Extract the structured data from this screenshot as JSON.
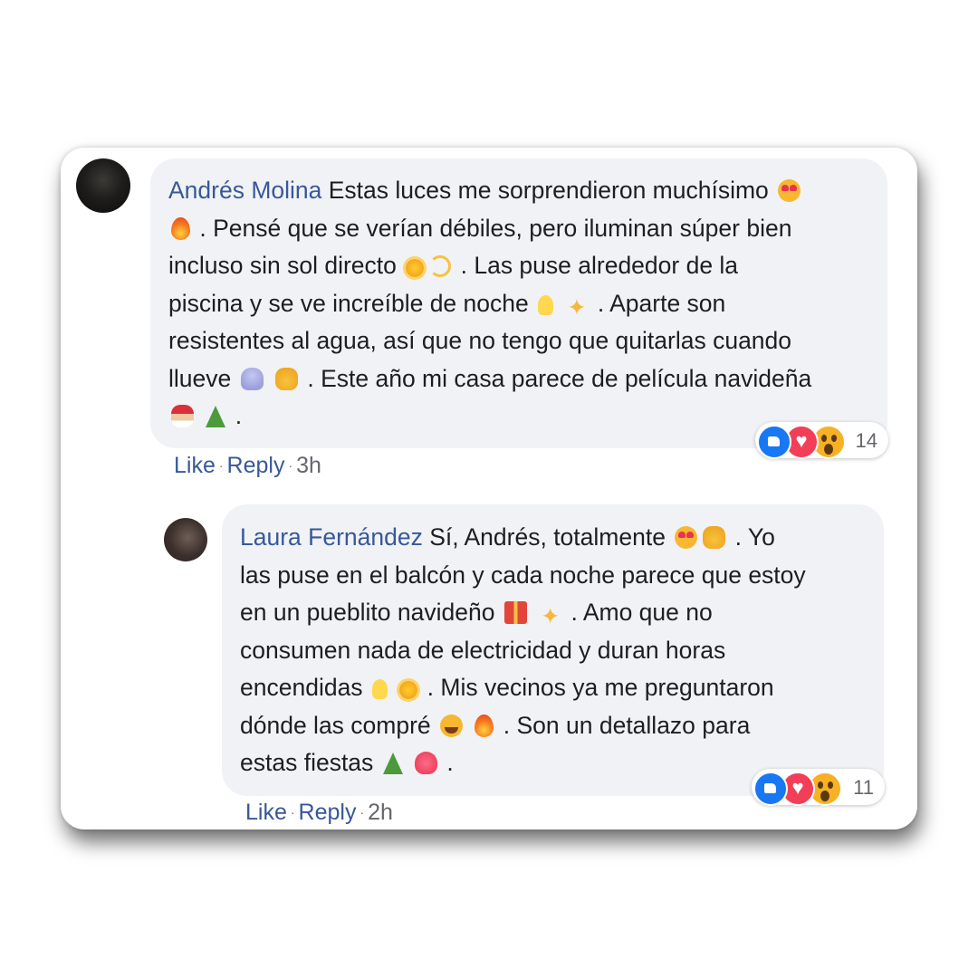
{
  "comments": [
    {
      "author": "Andrés Molina",
      "lines": [
        " Estas luces me sorprendieron muchísimo",
        " . Pensé que se verían débiles, pero iluminan súper bien",
        "incluso sin sol directo",
        " . Las puse alrededor de la",
        "piscina y se ve increíble de noche",
        " . Aparte son",
        "resistentes al agua, así que no tengo que quitarlas cuando",
        "llueve",
        " . Este año mi casa parece de película navideña",
        " ."
      ],
      "emojis": [
        "smiling-face-with-heart-eyes",
        "fire",
        "sun",
        "dizzy",
        "light-bulb",
        "sparkles",
        "cloud-with-rain",
        "raising-hands",
        "santa",
        "christmas-tree"
      ],
      "actions": {
        "like": "Like",
        "reply": "Reply",
        "time": "3h",
        "separator": "·"
      },
      "reactions": {
        "types": [
          "like-icon",
          "love-icon",
          "wow-icon"
        ],
        "count": "14",
        "colors": {
          "like": "#1877f2",
          "love": "#f33e58",
          "wow": "#f7b125"
        }
      }
    },
    {
      "author": "Laura Fernández",
      "lines": [
        " Sí, Andrés, totalmente",
        " . Yo",
        "las puse en el balcón y cada noche parece que estoy",
        "en un pueblito navideño",
        " . Amo que no",
        "consumen nada de electricidad y duran horas",
        "encendidas",
        " . Mis vecinos ya me preguntaron",
        "dónde las compré",
        " . Son un detallazo para",
        "estas fiestas",
        " ."
      ],
      "emojis": [
        "smiling-face-with-heart-eyes",
        "raising-hands",
        "gift",
        "sparkles",
        "light-bulb",
        "sun",
        "laughing",
        "fire",
        "christmas-tree",
        "sparkling-heart"
      ],
      "actions": {
        "like": "Like",
        "reply": "Reply",
        "time": "2h",
        "separator": "·"
      },
      "reactions": {
        "types": [
          "like-icon",
          "love-icon",
          "wow-icon"
        ],
        "count": "11",
        "colors": {
          "like": "#1877f2",
          "love": "#f33e58",
          "wow": "#f7b125"
        }
      }
    }
  ],
  "colors": {
    "author": "#385898",
    "bubble": "#f0f2f5",
    "meta": "#65676b",
    "text": "#1c1e21"
  }
}
